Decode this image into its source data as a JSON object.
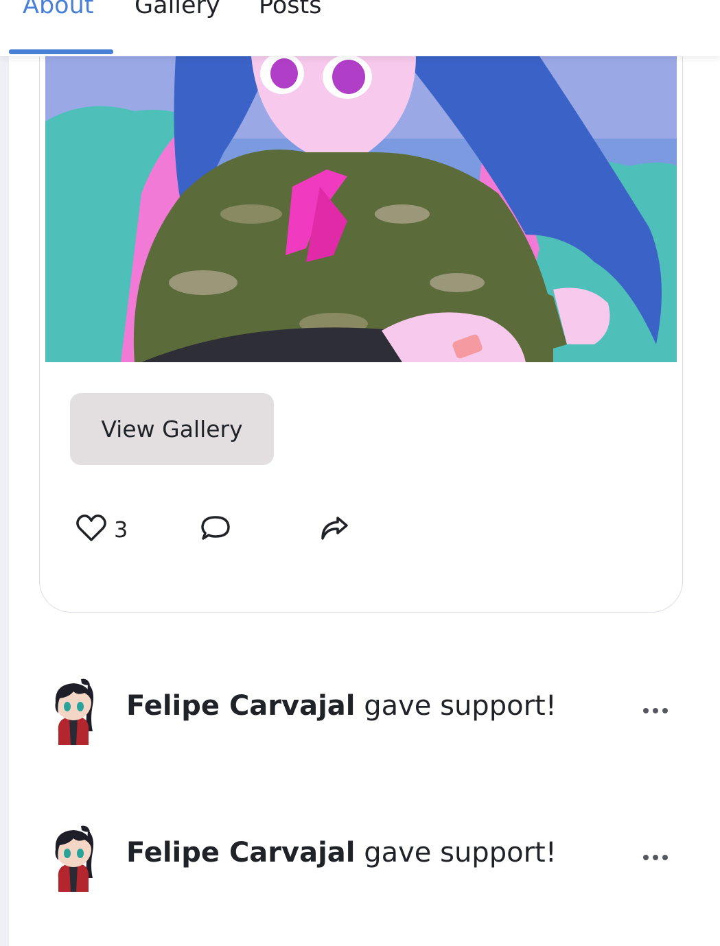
{
  "tabs": [
    {
      "label": "About",
      "active": true
    },
    {
      "label": "Gallery",
      "active": false
    },
    {
      "label": "Posts",
      "active": false
    }
  ],
  "colors": {
    "accent": "#4a7fd6",
    "button_bg": "#e3dedf"
  },
  "post": {
    "view_gallery_label": "View Gallery",
    "like_count": "3",
    "icons": [
      "heart-icon",
      "comment-icon",
      "share-icon"
    ]
  },
  "activity": [
    {
      "name": "Felipe Carvajal",
      "action": "gave support!",
      "icon": "more-dots-icon"
    },
    {
      "name": "Felipe Carvajal",
      "action": "gave support!",
      "icon": "more-dots-icon"
    }
  ]
}
